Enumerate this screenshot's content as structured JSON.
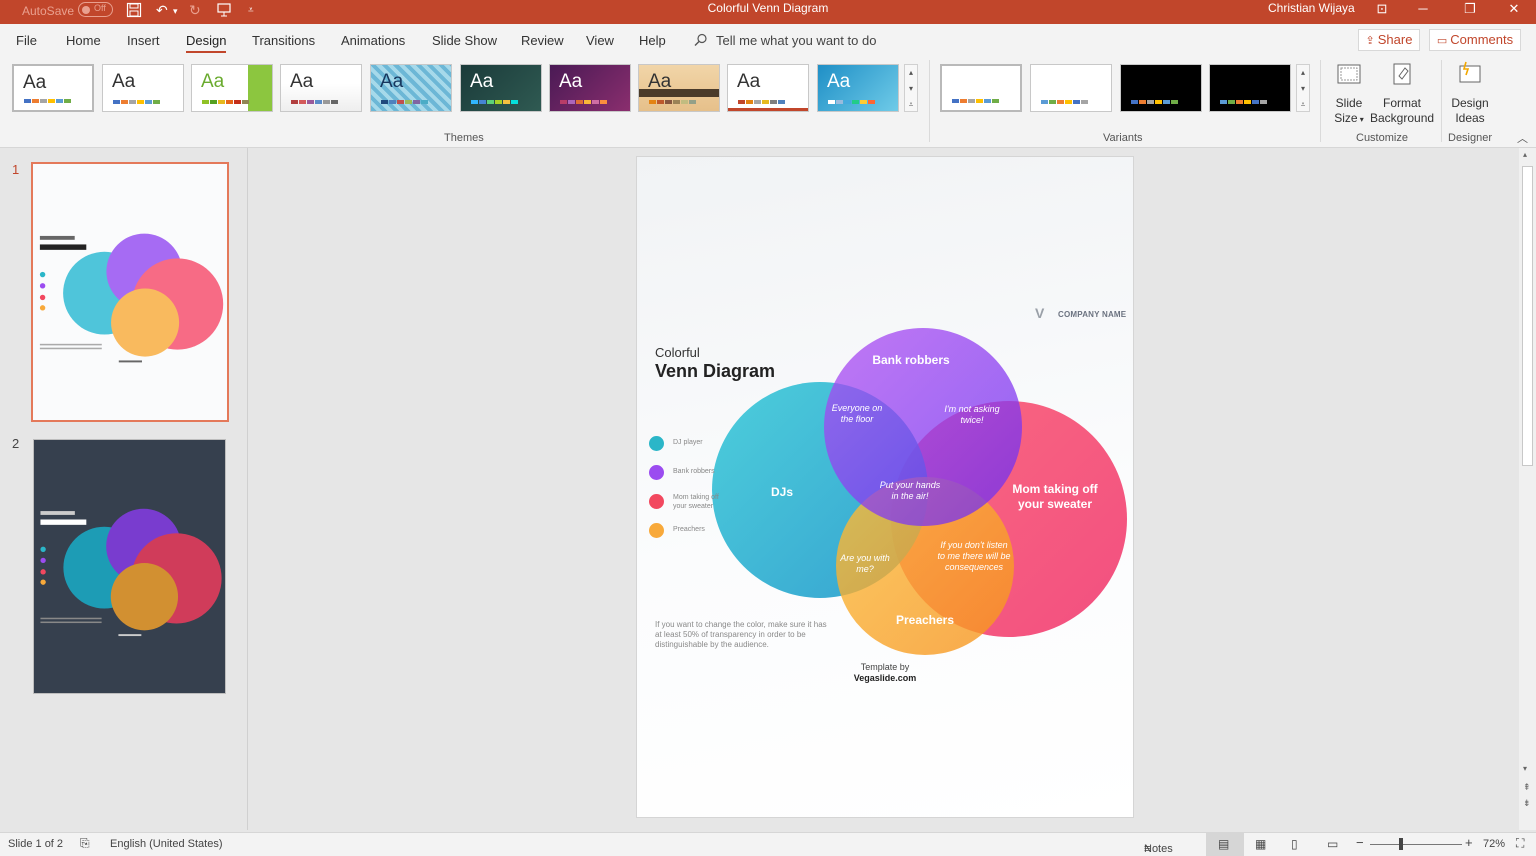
{
  "window": {
    "autosave_label": "AutoSave",
    "autosave_state": "Off",
    "title": "Colorful Venn Diagram",
    "user": "Christian Wijaya"
  },
  "tabs": [
    "File",
    "Home",
    "Insert",
    "Design",
    "Transitions",
    "Animations",
    "Slide Show",
    "Review",
    "View",
    "Help"
  ],
  "active_tab": "Design",
  "tell_me": "Tell me what you want to do",
  "share_label": "Share",
  "comments_label": "Comments",
  "ribbon": {
    "themes_label": "Themes",
    "variants_label": "Variants",
    "customize_label": "Customize",
    "designer_label": "Designer",
    "theme_aa": "Aa",
    "slide_size_1": "Slide",
    "slide_size_2": "Size",
    "format_bg_1": "Format",
    "format_bg_2": "Background",
    "design_ideas_1": "Design",
    "design_ideas_2": "Ideas"
  },
  "thumbnails": {
    "slide1_num": "1",
    "slide2_num": "2"
  },
  "slide": {
    "subtitle": "Colorful",
    "title": "Venn Diagram",
    "company": "COMPANY NAME",
    "logo_letter": "V",
    "legend": [
      {
        "label": "DJ player",
        "color": "#2bb6c8"
      },
      {
        "label": "Bank robbers",
        "color": "#9b4cf0"
      },
      {
        "label": "Mom taking off your sweater",
        "color": "#f2485f"
      },
      {
        "label": "Preachers",
        "color": "#f8a93a"
      }
    ],
    "circles": {
      "djs": "DJs",
      "bank_robbers": "Bank robbers",
      "mom": "Mom taking off your sweater",
      "preachers": "Preachers"
    },
    "intersections": {
      "everyone": "Everyone on the floor",
      "not_asking": "I'm not asking twice!",
      "hands": "Put your hands in the air!",
      "listen": "If you don't listen to me there will be consequences",
      "with_me": "Are you with me?"
    },
    "note": "If you want to change the color, make sure it has at least 50% of transparency in order to be distinguishable by the audience.",
    "credit_1": "Template by",
    "credit_2": "Vegaslide.com"
  },
  "status": {
    "slide_info": "Slide 1 of 2",
    "language": "English (United States)",
    "notes": "Notes",
    "zoom": "72%"
  }
}
